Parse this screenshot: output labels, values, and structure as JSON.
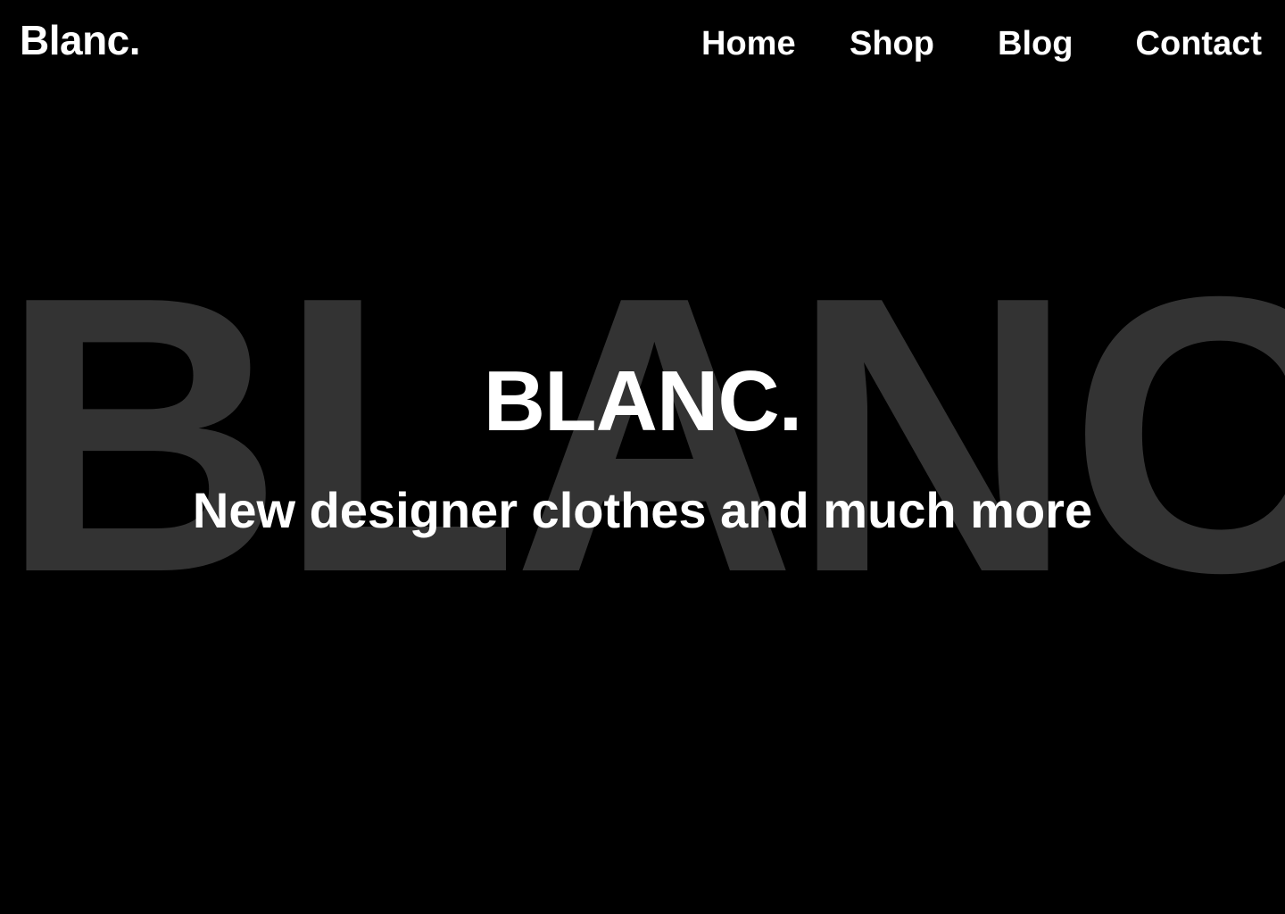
{
  "header": {
    "logo": "Blanc.",
    "nav": [
      {
        "label": "Home"
      },
      {
        "label": "Shop"
      },
      {
        "label": "Blog"
      },
      {
        "label": "Contact"
      }
    ]
  },
  "hero": {
    "background_word": "BLANC",
    "title": "BLANC.",
    "subtitle": "New designer clothes and much more"
  },
  "colors": {
    "background": "#000000",
    "text": "#ffffff",
    "background_word": "#333333"
  }
}
